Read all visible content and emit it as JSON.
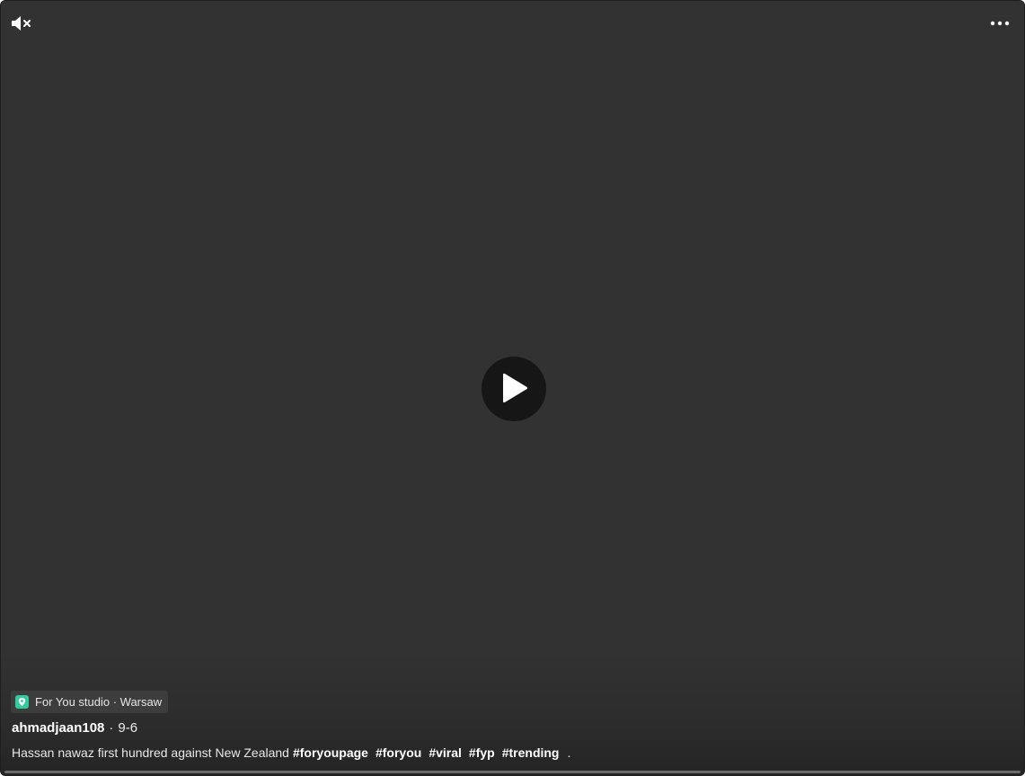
{
  "controls": {
    "mute_icon": "speaker-muted-icon",
    "more_icon": "more-horizontal-icon",
    "play_icon": "play-icon"
  },
  "location": {
    "icon": "map-pin-icon",
    "text": "For You studio · Warsaw",
    "icon_color": "#2fcc9e"
  },
  "post": {
    "author": "ahmadjaan108",
    "separator": "·",
    "date": "9-6",
    "description": "Hassan nawaz first hundred against New Zealand",
    "hashtags": [
      "#foryoupage",
      "#foryou",
      "#viral",
      "#fyp",
      "#trending"
    ],
    "tail": "."
  },
  "colors": {
    "background": "#323232",
    "play_button": "#161616"
  }
}
